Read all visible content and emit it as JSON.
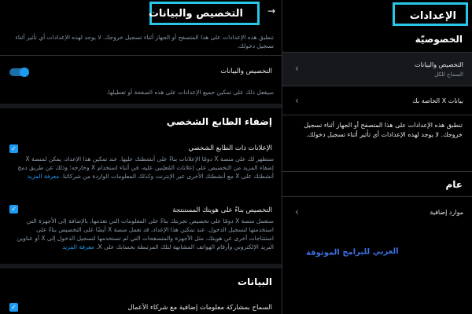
{
  "detail": {
    "title": "التخصيص والبيانات",
    "intro": "تنطبق هذه الإعدادات على هذا المتصفح أو الجهاز أثناء تسجيل خروجك. لا يوجد لهذه الإعدادات أي تأثير أثناء تسجيل دخولك.",
    "master": {
      "label": "التخصيص والبيانات",
      "desc": "سيفعل ذلك على تمكين جميع الإعدادات على هذه الصفحة أو تعطيلها.",
      "enabled": true
    },
    "personalization": {
      "section_title": "إضفاء الطابع الشخصي",
      "ads": {
        "label": "الإعلانات ذات الطابع الشخصي",
        "desc": "ستظهر لك على منصة X دومًا الإعلانات بناءً على أنشطتك عليها. عند تمكين هذا الإعداد، يمكن لمنصة X إضفاء المزيد من التخصيص على إعلانات المُعلِنين عليه، في أثناء استخدام X وخارجه؛ وذلك عن طريق دمج أنشطتك على X مع أنشطتك الأخرى عبر الإنترنت وكذلك المعلومات الواردة من شركائنا.",
        "learn_more": "معرفة المزيد",
        "checked": true
      },
      "identity": {
        "label": "التخصيص بناءً على هويتك المستنتجة",
        "desc": "ستعمل منصة X دومًا على تخصيص تجربتك بناءً على المعلومات التي تقدمها، بالإضافة إلى الأجهزة التي استخدمتها لتسجيل الدخول. عند تمكين هذا الإعداد، قد تعمل منصة X أيضًا على التخصيص بناءً على استنتاجات أخرى عن هويتك، مثل الأجهزة والمتصفحات التي لم تستخدمها لتسجيل الدخول إلى X أو عناوين البريد الإلكتروني وأرقام الهواتف المشابهة لتلك المرتبطة بحسابك على X.",
        "learn_more": "معرفة المزيد",
        "checked": true
      }
    },
    "data": {
      "section_title": "البيانات",
      "business": {
        "label": "السماح بمشاركة معلومات إضافية مع شركاء الأعمال",
        "checked": true
      }
    }
  },
  "settings": {
    "title": "الإعدادات",
    "privacy_title": "الخصوصيّة",
    "items": [
      {
        "label": "التخصيص والبيانات",
        "sub": "السماح للكل",
        "active": true
      },
      {
        "label": "بيانات X الخاصة بك",
        "sub": "",
        "active": false
      }
    ],
    "desc": "تنطبق هذه الإعدادات على هذا المتصفح أو الجهاز أثناء تسجيل خروجك. لا يوجد لهذه الإعدادات أي تأثير أثناء تسجيل دخولك.",
    "general_title": "عام",
    "general_items": [
      {
        "label": "موارد إضافية"
      }
    ]
  },
  "watermark": "العربي للبرامج الموثوقة",
  "colors": {
    "accent": "#1d9bf0",
    "highlight_box": "#29c6e8",
    "bg": "#000000",
    "divider": "#2f3336"
  }
}
